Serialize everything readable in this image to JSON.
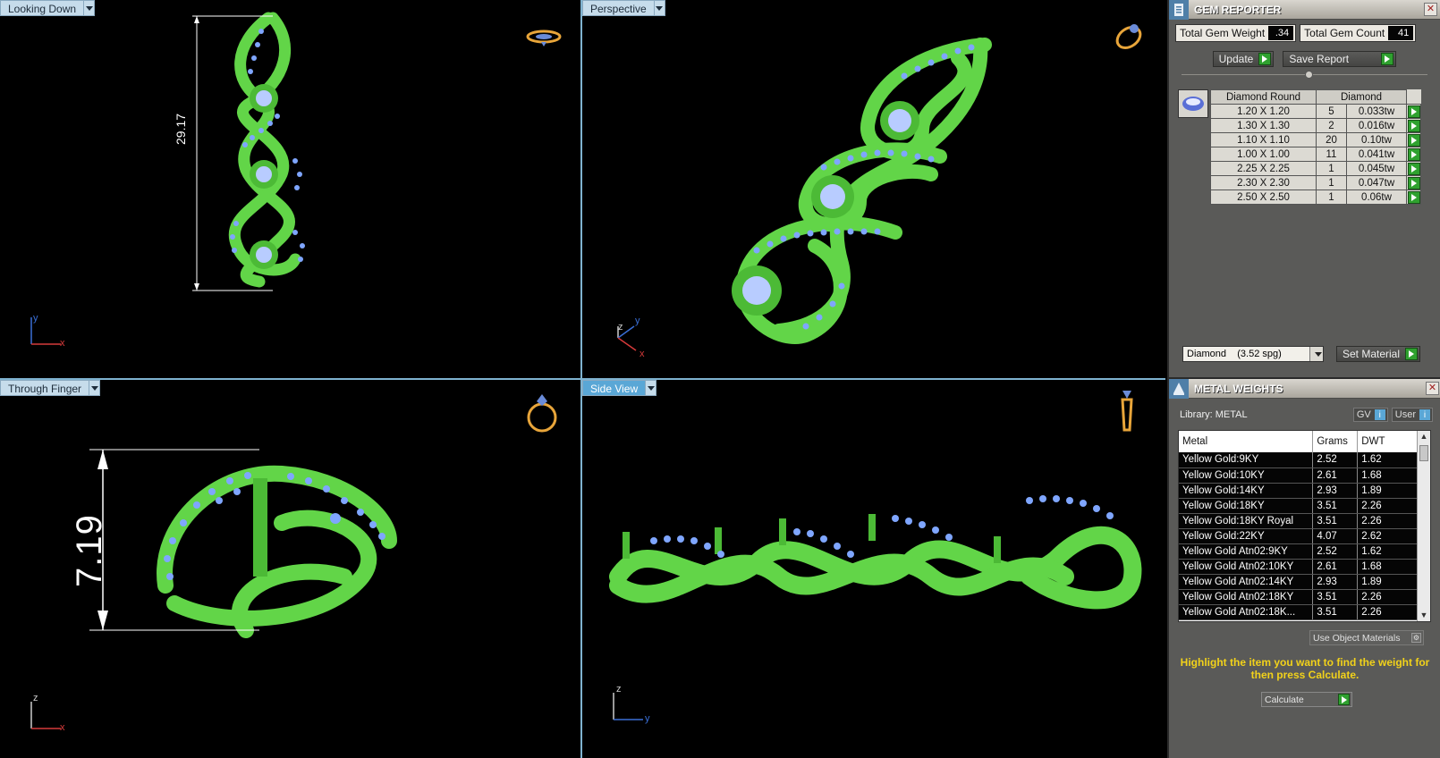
{
  "viewports": {
    "top_left": {
      "label": "Looking Down",
      "dimension": "29.17",
      "axes": {
        "h": "x",
        "v": "y"
      }
    },
    "top_right": {
      "label": "Perspective",
      "axes": {
        "a": "z",
        "b": "y",
        "c": "x"
      }
    },
    "bottom_left": {
      "label": "Through Finger",
      "dimension": "7.19",
      "axes": {
        "h": "x",
        "v": "z"
      }
    },
    "bottom_right": {
      "label": "Side View",
      "axes": {
        "h": "y",
        "v": "z"
      }
    }
  },
  "gem_reporter": {
    "title": "GEM REPORTER",
    "total_gem_weight_label": "Total Gem Weight",
    "total_gem_weight_value": ".34",
    "total_gem_count_label": "Total Gem Count",
    "total_gem_count_value": "41",
    "update_label": "Update",
    "save_report_label": "Save Report",
    "table_headers": [
      "Diamond Round",
      "Diamond"
    ],
    "rows": [
      {
        "size": "1.20 X 1.20",
        "count": "5",
        "weight": "0.033tw"
      },
      {
        "size": "1.30 X 1.30",
        "count": "2",
        "weight": "0.016tw"
      },
      {
        "size": "1.10 X 1.10",
        "count": "20",
        "weight": "0.10tw"
      },
      {
        "size": "1.00 X 1.00",
        "count": "11",
        "weight": "0.041tw"
      },
      {
        "size": "2.25 X 2.25",
        "count": "1",
        "weight": "0.045tw"
      },
      {
        "size": "2.30 X 2.30",
        "count": "1",
        "weight": "0.047tw"
      },
      {
        "size": "2.50 X 2.50",
        "count": "1",
        "weight": "0.06tw"
      }
    ],
    "material_select": "Diamond    (3.52 spg)",
    "set_material_label": "Set Material"
  },
  "metal_weights": {
    "title": "METAL WEIGHTS",
    "library_label": "Library: METAL",
    "gv_label": "GV",
    "user_label": "User",
    "headers": [
      "Metal",
      "Grams",
      "DWT"
    ],
    "rows": [
      {
        "metal": "Yellow Gold:9KY",
        "grams": "2.52",
        "dwt": "1.62"
      },
      {
        "metal": "Yellow Gold:10KY",
        "grams": "2.61",
        "dwt": "1.68"
      },
      {
        "metal": "Yellow Gold:14KY",
        "grams": "2.93",
        "dwt": "1.89"
      },
      {
        "metal": "Yellow Gold:18KY",
        "grams": "3.51",
        "dwt": "2.26"
      },
      {
        "metal": "Yellow Gold:18KY Royal",
        "grams": "3.51",
        "dwt": "2.26"
      },
      {
        "metal": "Yellow Gold:22KY",
        "grams": "4.07",
        "dwt": "2.62"
      },
      {
        "metal": "Yellow Gold Atn02:9KY",
        "grams": "2.52",
        "dwt": "1.62"
      },
      {
        "metal": "Yellow Gold Atn02:10KY",
        "grams": "2.61",
        "dwt": "1.68"
      },
      {
        "metal": "Yellow Gold Atn02:14KY",
        "grams": "2.93",
        "dwt": "1.89"
      },
      {
        "metal": "Yellow Gold Atn02:18KY",
        "grams": "3.51",
        "dwt": "2.26"
      },
      {
        "metal": "Yellow Gold Atn02:18K...",
        "grams": "3.51",
        "dwt": "2.26"
      }
    ],
    "use_object_materials_label": "Use Object Materials",
    "hint": "Highlight the item you want to find the weight for then press Calculate.",
    "calculate_label": "Calculate"
  },
  "colors": {
    "model_green": "#6fdc50",
    "gem_blue": "#8fb0ff",
    "accent_blue": "#5aa7d6",
    "hint_yellow": "#f2d21a"
  }
}
